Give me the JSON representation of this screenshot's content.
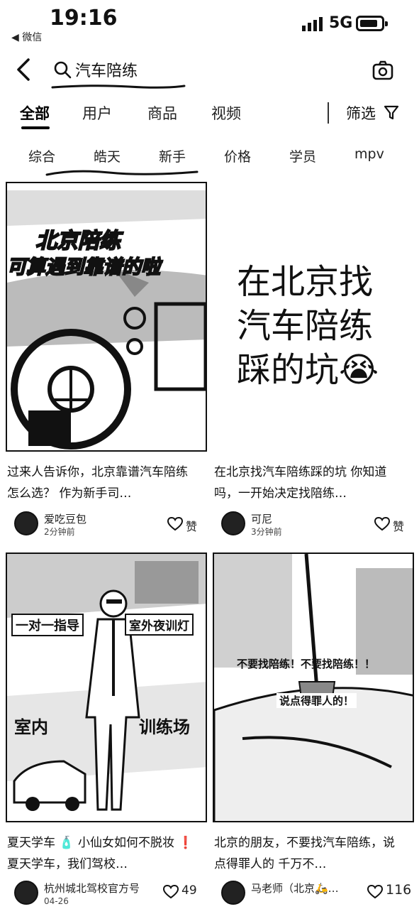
{
  "status": {
    "time": "19:16",
    "back_app": "◀ 微信",
    "network": "5G"
  },
  "search": {
    "query": "汽车陪练"
  },
  "tabs": [
    {
      "label": "全部",
      "active": true
    },
    {
      "label": "用户"
    },
    {
      "label": "商品"
    },
    {
      "label": "视频"
    }
  ],
  "filter": {
    "label": "筛选"
  },
  "chips": [
    "综合",
    "皓天",
    "新手",
    "价格",
    "学员",
    "mpv"
  ],
  "cards": [
    {
      "image_text_1": "北京陪练",
      "image_text_2": "可算遇到靠谱的啦",
      "desc": "过来人告诉你，北京靠谱汽车陪练怎么选？ 作为新手司…",
      "author": "爱吃豆包",
      "time": "2分钟前",
      "like": "赞"
    },
    {
      "image_text_1": "在北京找",
      "image_text_2": "汽车陪练",
      "image_text_3": "踩的坑😭",
      "desc": "在北京找汽车陪练踩的坑 你知道吗，一开始决定找陪练…",
      "author": "可尼",
      "time": "3分钟前",
      "like": "赞"
    },
    {
      "image_text_1": "一对一指导",
      "image_text_2": "室外夜训灯",
      "image_text_3": "室内",
      "image_text_4": "训练场",
      "desc": "夏天学车 🧴 小仙女如何不脱妆 ❗ 夏天学车，我们驾校…",
      "author": "杭州城北驾校官方号",
      "time": "04-26",
      "like": "49"
    },
    {
      "image_text_1": "不要找陪练！不要找陪练！！",
      "image_text_2": "说点得罪人的！",
      "desc": "北京的朋友，不要找汽车陪练，说点得罪人的 千万不…",
      "author": "马老师（北京🛵…",
      "time": "",
      "like": "116"
    }
  ]
}
